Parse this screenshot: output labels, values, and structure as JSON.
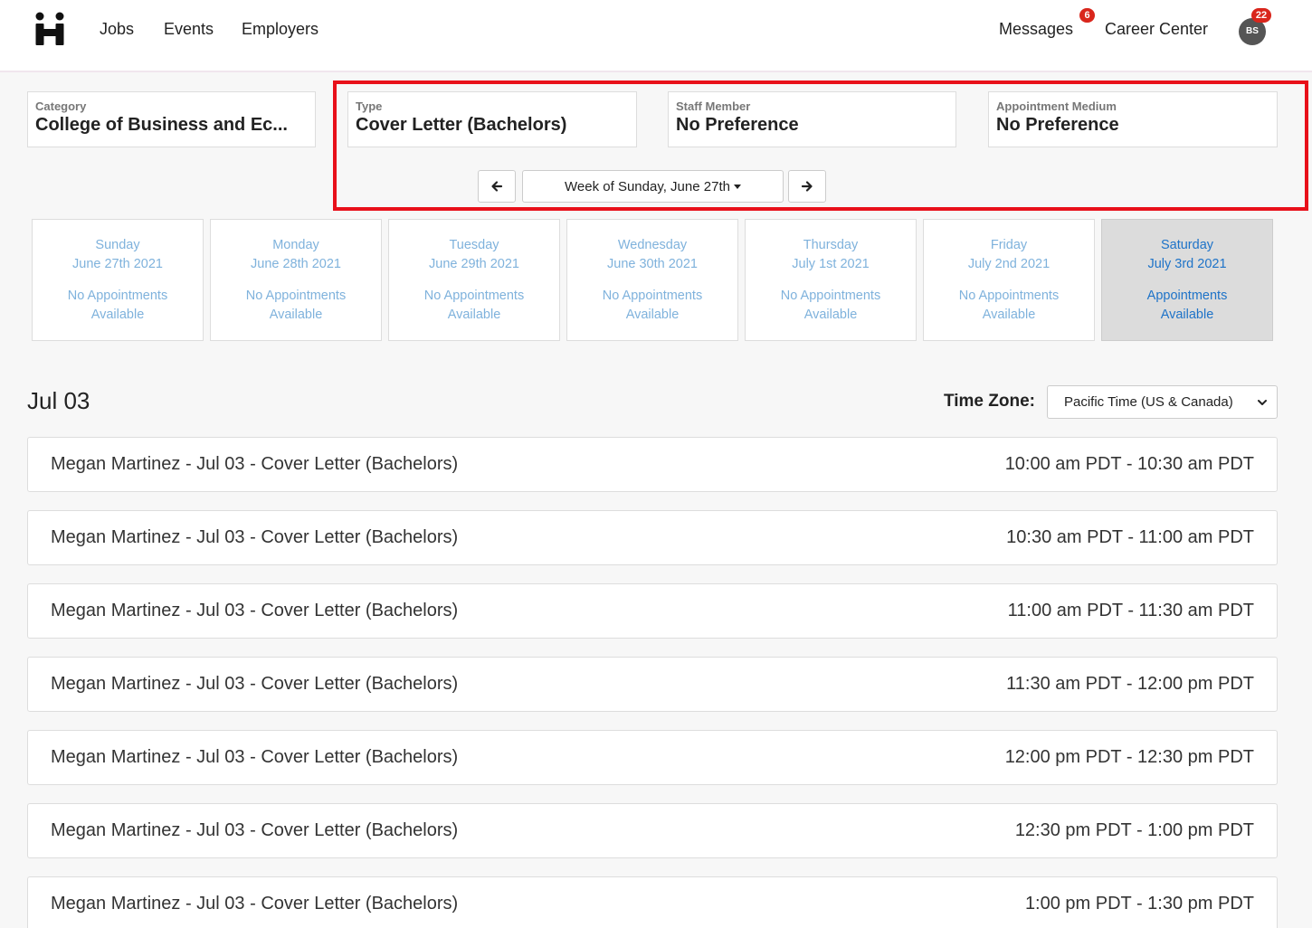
{
  "nav": {
    "links": [
      "Jobs",
      "Events",
      "Employers"
    ],
    "messages_label": "Messages",
    "messages_count": "6",
    "career_center_label": "Career Center",
    "avatar_initials": "BS",
    "notifications_count": "22"
  },
  "filters": {
    "category": {
      "label": "Category",
      "value": "College of Business and Ec..."
    },
    "type": {
      "label": "Type",
      "value": "Cover Letter (Bachelors)"
    },
    "staff": {
      "label": "Staff Member",
      "value": "No Preference"
    },
    "medium": {
      "label": "Appointment Medium",
      "value": "No Preference"
    }
  },
  "week": {
    "label": "Week of Sunday, June 27th"
  },
  "days": [
    {
      "day": "Sunday",
      "date": "June 27th 2021",
      "status1": "No Appointments",
      "status2": "Available"
    },
    {
      "day": "Monday",
      "date": "June 28th 2021",
      "status1": "No Appointments",
      "status2": "Available"
    },
    {
      "day": "Tuesday",
      "date": "June 29th 2021",
      "status1": "No Appointments",
      "status2": "Available"
    },
    {
      "day": "Wednesday",
      "date": "June 30th 2021",
      "status1": "No Appointments",
      "status2": "Available"
    },
    {
      "day": "Thursday",
      "date": "July 1st 2021",
      "status1": "No Appointments",
      "status2": "Available"
    },
    {
      "day": "Friday",
      "date": "July 2nd 2021",
      "status1": "No Appointments",
      "status2": "Available"
    },
    {
      "day": "Saturday",
      "date": "July 3rd 2021",
      "status1": "Appointments",
      "status2": "Available"
    }
  ],
  "selected_date": "Jul 03",
  "timezone": {
    "label": "Time Zone:",
    "value": "Pacific Time (US & Canada)"
  },
  "appointments": [
    {
      "title": "Megan Martinez - Jul 03 - Cover Letter (Bachelors)",
      "time": "10:00 am PDT - 10:30 am PDT"
    },
    {
      "title": "Megan Martinez - Jul 03 - Cover Letter (Bachelors)",
      "time": "10:30 am PDT - 11:00 am PDT"
    },
    {
      "title": "Megan Martinez - Jul 03 - Cover Letter (Bachelors)",
      "time": "11:00 am PDT - 11:30 am PDT"
    },
    {
      "title": "Megan Martinez - Jul 03 - Cover Letter (Bachelors)",
      "time": "11:30 am PDT - 12:00 pm PDT"
    },
    {
      "title": "Megan Martinez - Jul 03 - Cover Letter (Bachelors)",
      "time": "12:00 pm PDT - 12:30 pm PDT"
    },
    {
      "title": "Megan Martinez - Jul 03 - Cover Letter (Bachelors)",
      "time": "12:30 pm PDT - 1:00 pm PDT"
    },
    {
      "title": "Megan Martinez - Jul 03 - Cover Letter (Bachelors)",
      "time": "1:00 pm PDT - 1:30 pm PDT"
    }
  ],
  "colors": {
    "accent": "#1e73c8",
    "badge": "#d9261c",
    "highlight": "#e8101a"
  }
}
